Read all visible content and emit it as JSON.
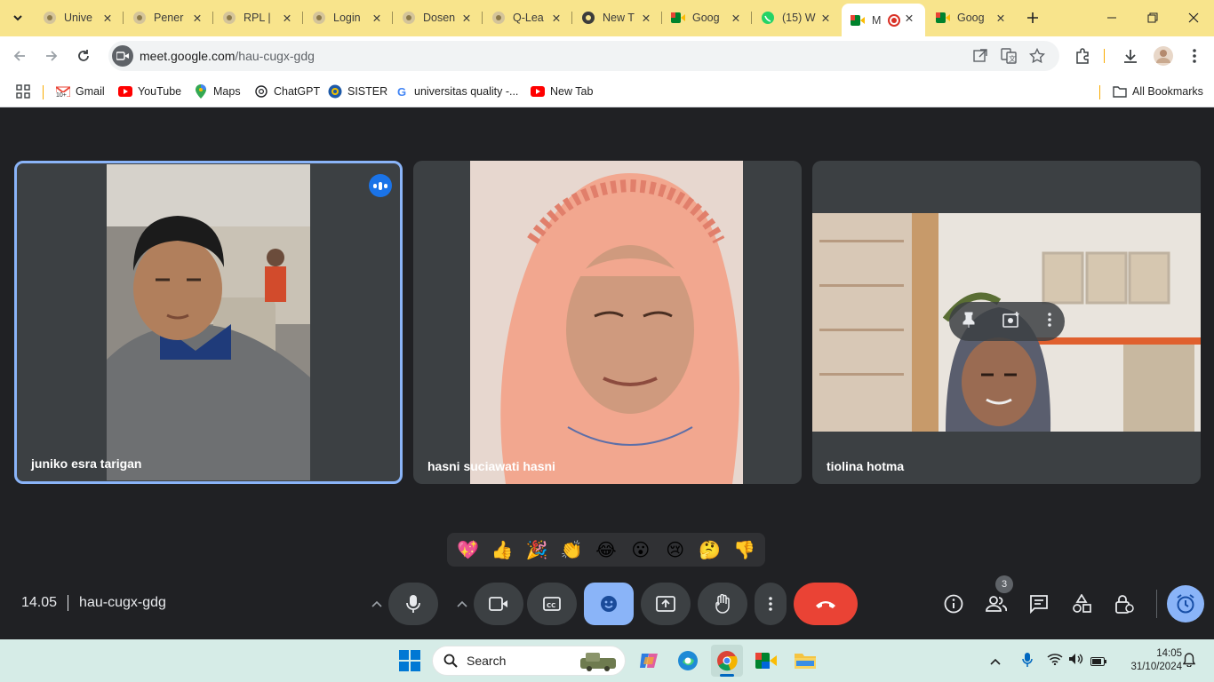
{
  "browser": {
    "tabs": [
      {
        "title": "Unive",
        "icon": "university-icon"
      },
      {
        "title": "Pener",
        "icon": "university-icon"
      },
      {
        "title": "RPL |",
        "icon": "university-icon"
      },
      {
        "title": "Login",
        "icon": "university-icon"
      },
      {
        "title": "Dosen",
        "icon": "university-icon"
      },
      {
        "title": "Q-Lea",
        "icon": "university-icon"
      },
      {
        "title": "New T",
        "icon": "chrome-icon"
      },
      {
        "title": "Goog",
        "icon": "google-meet-icon"
      },
      {
        "title": "(15) W",
        "icon": "whatsapp-icon"
      },
      {
        "title": "M",
        "icon": "google-meet-icon",
        "active": true
      },
      {
        "title": "Goog",
        "icon": "google-meet-icon"
      }
    ],
    "url_host": "meet.google.com",
    "url_path": "/hau-cugx-gdg",
    "bookmarks": [
      {
        "label": "Gmail",
        "icon": "gmail-icon"
      },
      {
        "label": "YouTube",
        "icon": "youtube-icon"
      },
      {
        "label": "Maps",
        "icon": "maps-icon"
      },
      {
        "label": "ChatGPT",
        "icon": "chatgpt-icon"
      },
      {
        "label": "SISTER",
        "icon": "sister-icon"
      },
      {
        "label": "universitas quality -...",
        "icon": "google-icon"
      },
      {
        "label": "New Tab",
        "icon": "youtube-icon"
      }
    ],
    "all_bookmarks": "All Bookmarks",
    "gmail_badge": "10+"
  },
  "meet": {
    "participants": [
      {
        "name": "juniko esra tarigan",
        "speaking": true
      },
      {
        "name": "hasni suciawati hasni",
        "speaking": false
      },
      {
        "name": "tiolina hotma",
        "speaking": false
      }
    ],
    "reactions": [
      "💖",
      "👍",
      "🎉",
      "👏",
      "😂",
      "😮",
      "😢",
      "🤔",
      "👎"
    ],
    "time": "14.05",
    "meeting_code": "hau-cugx-gdg",
    "people_count": "3"
  },
  "taskbar": {
    "search_placeholder": "Search",
    "clock_time": "14:05",
    "clock_date": "31/10/2024"
  },
  "colors": {
    "tabstrip": "#f8e48c",
    "meet_bg": "#202124",
    "tile_bg": "#3c4043",
    "accent_blue": "#8ab4f8",
    "end_call_red": "#ea4335",
    "taskbar": "#d6ece7"
  }
}
